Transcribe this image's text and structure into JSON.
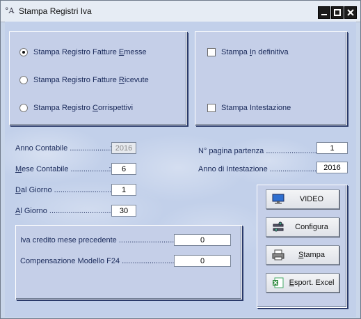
{
  "window": {
    "title": "Stampa Registri Iva",
    "icon": "app-icon"
  },
  "registri": {
    "options": [
      {
        "label_pre": "Stampa Registro Fatture ",
        "label_u": "E",
        "label_post": "messe",
        "selected": true
      },
      {
        "label_pre": "Stampa Registro Fatture ",
        "label_u": "R",
        "label_post": "icevute",
        "selected": false
      },
      {
        "label_pre": "Stampa Registro ",
        "label_u": "C",
        "label_post": "orrispettivi",
        "selected": false
      }
    ]
  },
  "opzioni": {
    "definitiva": {
      "label_pre": "Stampa ",
      "label_u": "I",
      "label_post": "n definitiva",
      "checked": false
    },
    "intestazione": {
      "label": "Stampa Intestazione",
      "checked": false
    }
  },
  "fields": {
    "anno_contabile": {
      "label": "Anno Contabile ...................:",
      "value": "2016"
    },
    "mese_contabile": {
      "label_u": "M",
      "label_post": "ese Contabile ..................:",
      "value": "6"
    },
    "dal_giorno": {
      "label_u": "D",
      "label_post": "al Giorno ............................:",
      "value": "1"
    },
    "al_giorno": {
      "label_u": "A",
      "label_post": "l Giorno ..............................:",
      "value": "30"
    },
    "pagina_partenza": {
      "label": "N° pagina partenza .........................:",
      "value": "1"
    },
    "anno_intestazione": {
      "label": "Anno di Intestazione ......................:",
      "value": "2016"
    },
    "iva_credito": {
      "label": "Iva credito mese precedente ..........................:",
      "value": "0"
    },
    "compensazione": {
      "label": "Compensazione Modello F24 ..........................:",
      "value": "0"
    }
  },
  "buttons": {
    "video": "VIDEO",
    "configura": "Configura",
    "stampa_u": "S",
    "stampa_post": "tampa",
    "excel_u": "E",
    "excel_post": "sport. Excel"
  }
}
